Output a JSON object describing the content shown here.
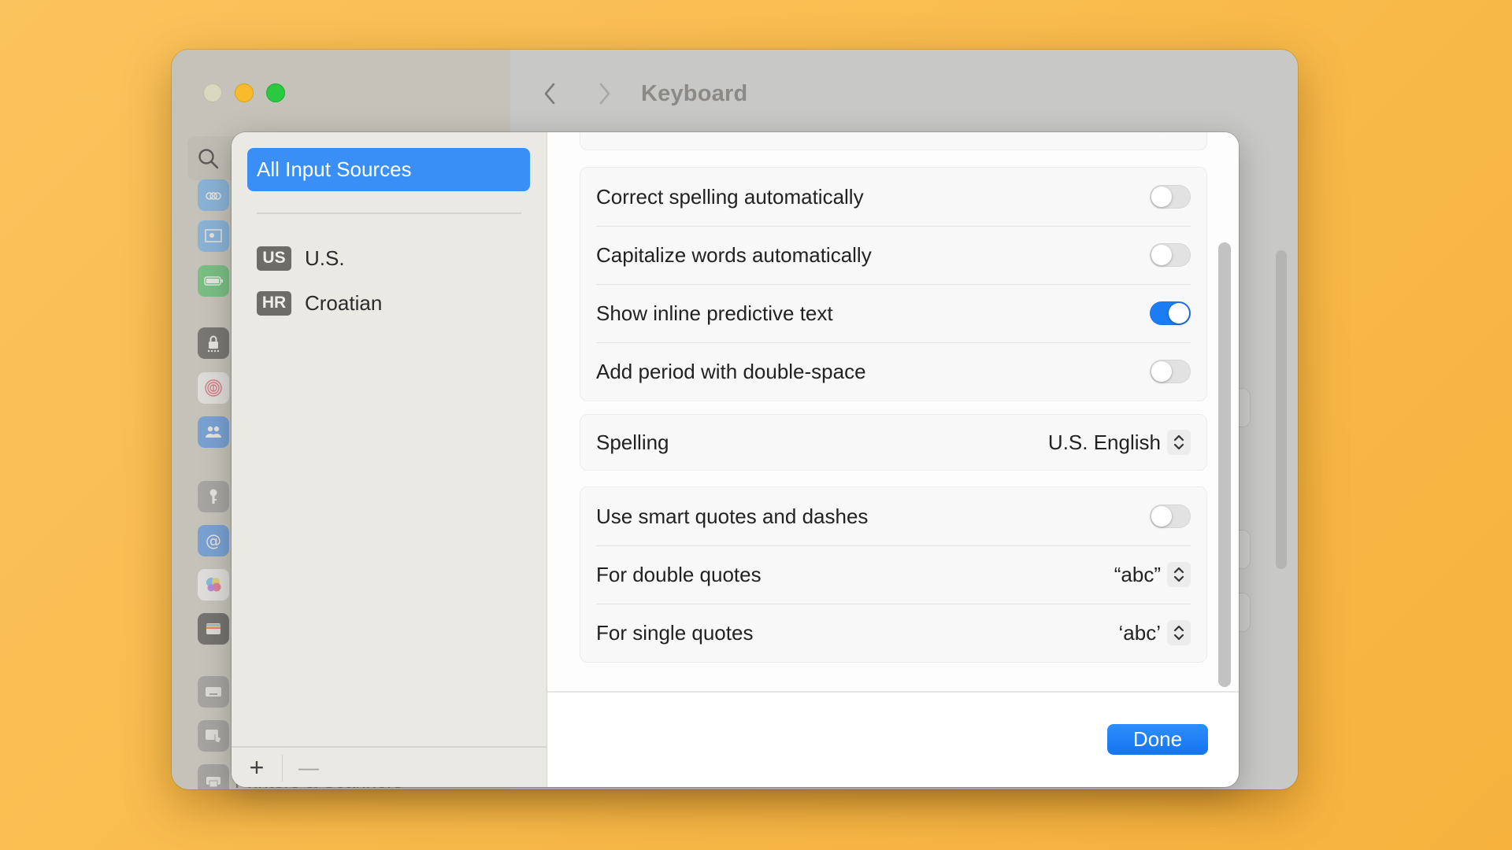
{
  "window": {
    "title": "Keyboard",
    "traffic_lights": [
      "close",
      "minimize",
      "maximize"
    ],
    "nav": {
      "back_icon": "chevron-left-icon",
      "forward_icon": "chevron-right-icon"
    },
    "search_icon": "search-icon",
    "sidebar_icons": [
      "screen-saver-icon",
      "desktop-dock-icon",
      "battery-icon",
      "lock-screen-icon",
      "touch-id-icon",
      "users-groups-icon",
      "passwords-icon",
      "internet-accounts-icon",
      "game-center-icon",
      "wallet-icon",
      "keyboard-icon",
      "trackpad-icon",
      "printers-icon"
    ],
    "background_partial_text": "Printers & Scanners"
  },
  "sheet": {
    "left": {
      "selected_item": "All Input Sources",
      "sources": [
        {
          "badge": "US",
          "label": "U.S."
        },
        {
          "badge": "HR",
          "label": "Croatian"
        }
      ],
      "footer": {
        "add": "+",
        "remove": "—"
      }
    },
    "right": {
      "toggle_group": [
        {
          "label": "Correct spelling automatically",
          "on": false
        },
        {
          "label": "Capitalize words automatically",
          "on": false
        },
        {
          "label": "Show inline predictive text",
          "on": true
        },
        {
          "label": "Add period with double-space",
          "on": false
        }
      ],
      "spelling": {
        "label": "Spelling",
        "value": "U.S. English"
      },
      "quotes_group": {
        "smart_quotes": {
          "label": "Use smart quotes and dashes",
          "on": false
        },
        "double_quotes": {
          "label": "For double quotes",
          "value": "“abc”"
        },
        "single_quotes": {
          "label": "For single quotes",
          "value": "‘abc’"
        }
      }
    },
    "done_label": "Done",
    "accent_color": "#1c7cf4"
  }
}
